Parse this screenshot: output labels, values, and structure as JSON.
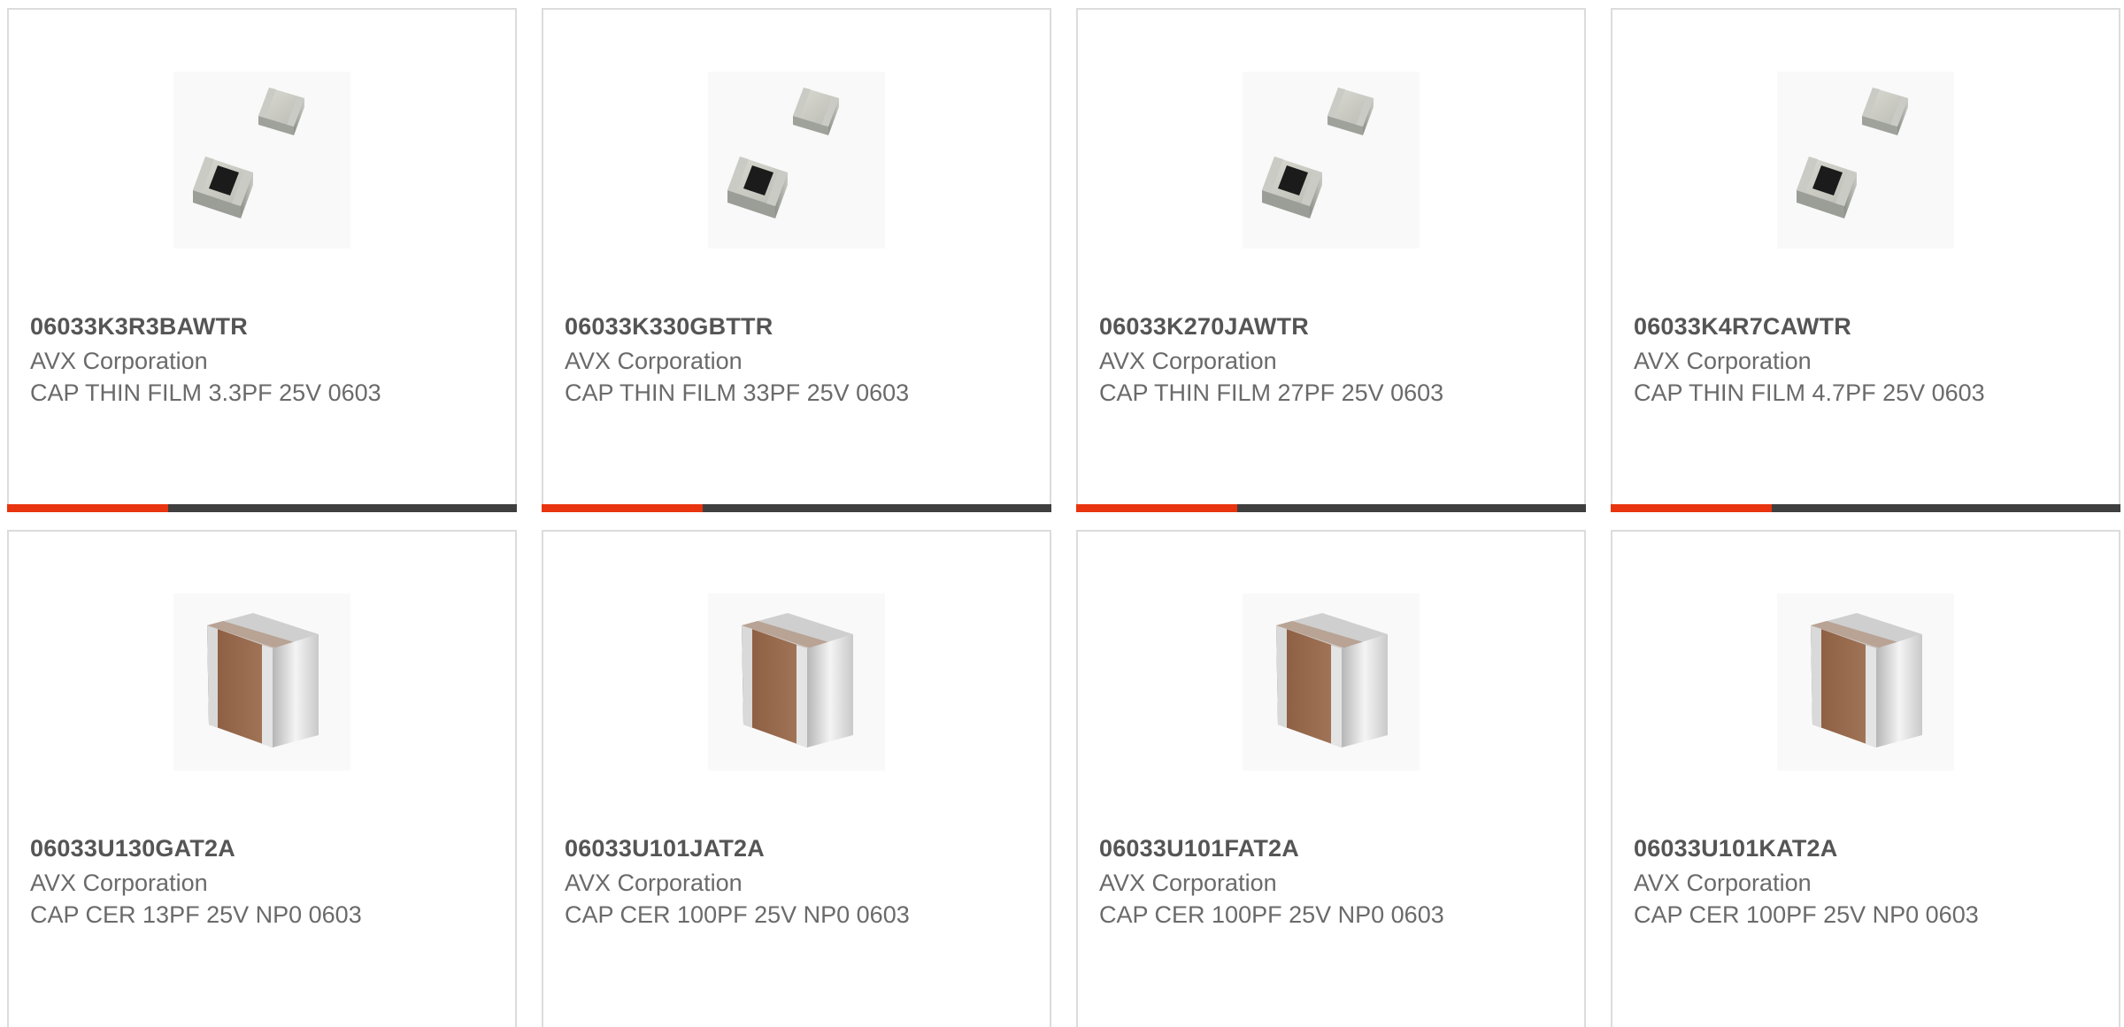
{
  "accent_color": "#e8340f",
  "bar_color": "#3f3f3f",
  "cards": [
    {
      "part_number": "06033K3R3BAWTR",
      "manufacturer": "AVX Corporation",
      "description": "CAP THIN FILM 3.3PF 25V 0603",
      "image": "thin-film-chip-capacitor-icon"
    },
    {
      "part_number": "06033K330GBTTR",
      "manufacturer": "AVX Corporation",
      "description": "CAP THIN FILM 33PF 25V 0603",
      "image": "thin-film-chip-capacitor-icon"
    },
    {
      "part_number": "06033K270JAWTR",
      "manufacturer": "AVX Corporation",
      "description": "CAP THIN FILM 27PF 25V 0603",
      "image": "thin-film-chip-capacitor-icon"
    },
    {
      "part_number": "06033K4R7CAWTR",
      "manufacturer": "AVX Corporation",
      "description": "CAP THIN FILM 4.7PF 25V 0603",
      "image": "thin-film-chip-capacitor-icon"
    },
    {
      "part_number": "06033U130GAT2A",
      "manufacturer": "AVX Corporation",
      "description": "CAP CER 13PF 25V NP0 0603",
      "image": "ceramic-chip-capacitor-icon"
    },
    {
      "part_number": "06033U101JAT2A",
      "manufacturer": "AVX Corporation",
      "description": "CAP CER 100PF 25V NP0 0603",
      "image": "ceramic-chip-capacitor-icon"
    },
    {
      "part_number": "06033U101FAT2A",
      "manufacturer": "AVX Corporation",
      "description": "CAP CER 100PF 25V NP0 0603",
      "image": "ceramic-chip-capacitor-icon"
    },
    {
      "part_number": "06033U101KAT2A",
      "manufacturer": "AVX Corporation",
      "description": "CAP CER 100PF 25V NP0 0603",
      "image": "ceramic-chip-capacitor-icon"
    }
  ]
}
